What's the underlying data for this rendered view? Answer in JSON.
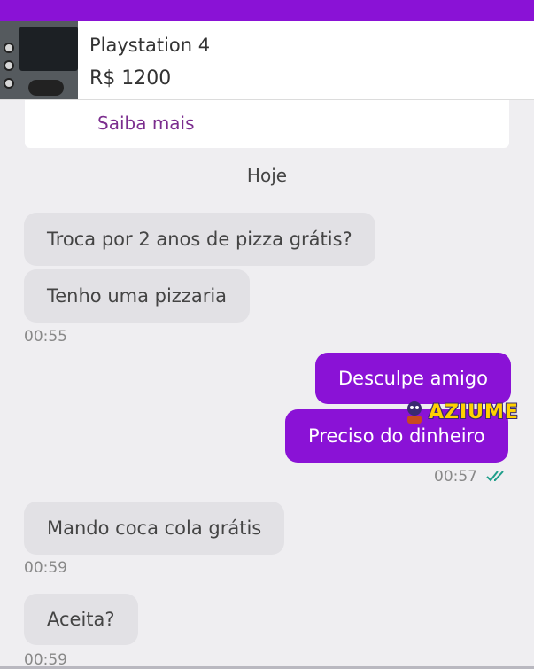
{
  "product": {
    "name": "Playstation 4",
    "price": "R$ 1200",
    "link": "Saiba mais"
  },
  "chat": {
    "date_divider": "Hoje",
    "messages": [
      {
        "from": "them",
        "text": "Troca por 2 anos de pizza grátis?"
      },
      {
        "from": "them",
        "text": "Tenho uma pizzaria",
        "time": "00:55"
      },
      {
        "from": "me",
        "text": "Desculpe amigo"
      },
      {
        "from": "me",
        "text": "Preciso do dinheiro",
        "time": "00:57",
        "status": "read"
      },
      {
        "from": "them",
        "text": "Mando coca cola grátis",
        "time": "00:59"
      },
      {
        "from": "them",
        "text": "Aceita?",
        "time": "00:59"
      }
    ]
  },
  "watermark": {
    "text": "AZIUME"
  },
  "colors": {
    "accent": "#8a12d6",
    "incoming_bubble": "#e2e1e5",
    "link": "#7b2d8e",
    "read_check": "#1f9e8a",
    "watermark": "#ffd200"
  },
  "icons": [
    "product-thumbnail",
    "double-check-icon",
    "mascot-icon"
  ]
}
